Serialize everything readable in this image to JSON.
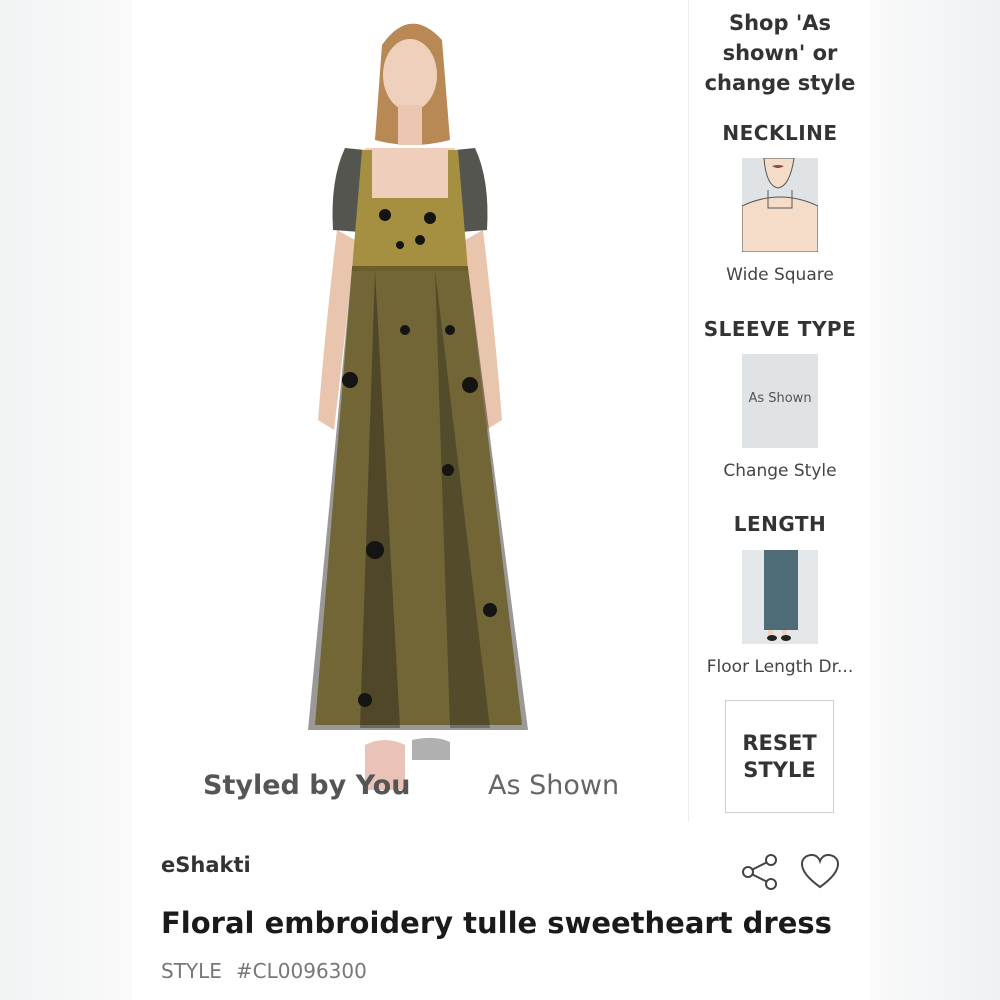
{
  "colors": {
    "accent_text": "#333333",
    "swatch_bg": "#dfe3e5",
    "dress_lining": "#b8a14e",
    "tulle": "#1c1c1a"
  },
  "photo": {
    "alt": "model-wearing-dress"
  },
  "view_tabs": {
    "styled": "Styled by You",
    "shown": "As Shown"
  },
  "panel": {
    "heading": "Shop 'As shown' or change style",
    "sections": [
      {
        "title": "NECKLINE",
        "option": "Wide Square",
        "swatch": "neckline-illustration"
      },
      {
        "title": "SLEEVE TYPE",
        "option": "Change Style",
        "swatch_text": "As Shown"
      },
      {
        "title": "LENGTH",
        "option": "Floor Length Dr...",
        "swatch": "length-illustration"
      }
    ],
    "reset_label": "RESET STYLE"
  },
  "product": {
    "brand": "eShakti",
    "title": "Floral embroidery tulle sweetheart dress",
    "style_label": "STYLE",
    "style_code": "#CL0096300"
  },
  "icons": {
    "share": "share-icon",
    "favorite": "heart-icon"
  }
}
